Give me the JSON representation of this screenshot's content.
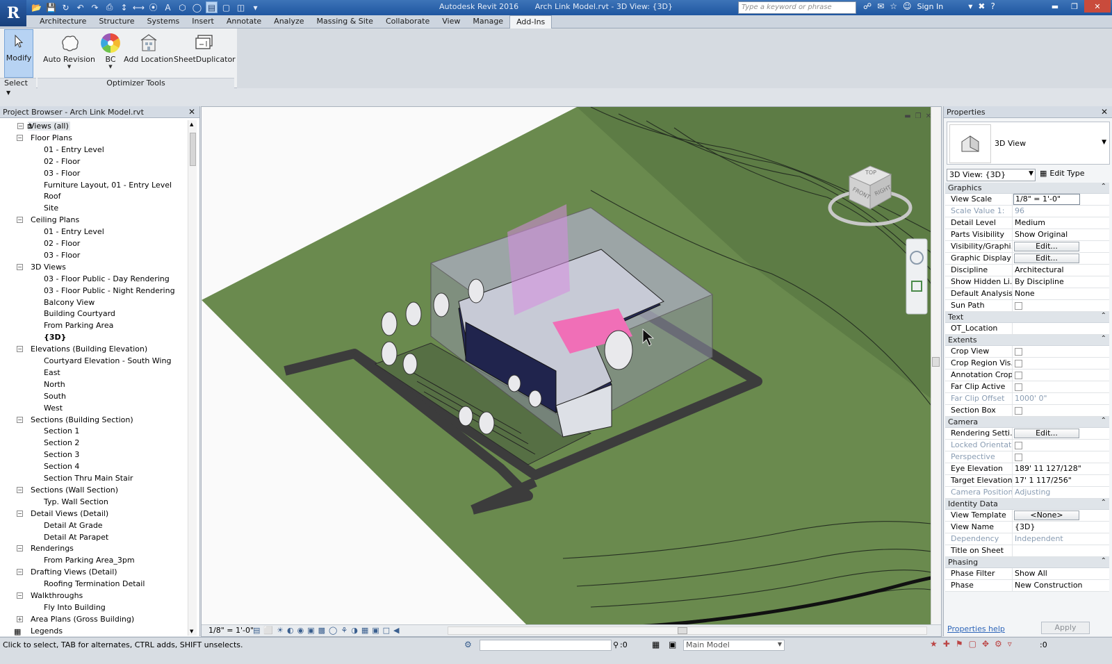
{
  "titlebar": {
    "app_letter": "R",
    "app_name": "Autodesk Revit 2016",
    "document": "Arch Link Model.rvt - 3D View: {3D}",
    "search_placeholder": "Type a keyword or phrase",
    "sign_in": "Sign In"
  },
  "tabs": [
    "Architecture",
    "Structure",
    "Systems",
    "Insert",
    "Annotate",
    "Analyze",
    "Massing & Site",
    "Collaborate",
    "View",
    "Manage",
    "Add-Ins"
  ],
  "active_tab": "Add-Ins",
  "ribbon": {
    "modify": "Modify",
    "auto_revision": "Auto Revision",
    "bc": "BC",
    "add_location": "Add Location",
    "sheet_duplicator": "SheetDuplicator",
    "select_label": "Select",
    "panel_label": "Optimizer Tools"
  },
  "project_browser": {
    "title": "Project Browser - Arch Link Model.rvt",
    "items": [
      {
        "label": "Views (all)",
        "level": 0,
        "expander": "-",
        "selected": true
      },
      {
        "label": "Floor Plans",
        "level": 1,
        "expander": "-"
      },
      {
        "label": "01 - Entry Level",
        "level": 2
      },
      {
        "label": "02 - Floor",
        "level": 2
      },
      {
        "label": "03 - Floor",
        "level": 2
      },
      {
        "label": "Furniture Layout,  01 - Entry Level",
        "level": 2
      },
      {
        "label": "Roof",
        "level": 2
      },
      {
        "label": "Site",
        "level": 2
      },
      {
        "label": "Ceiling Plans",
        "level": 1,
        "expander": "-"
      },
      {
        "label": "01 - Entry Level",
        "level": 2
      },
      {
        "label": "02 - Floor",
        "level": 2
      },
      {
        "label": "03 - Floor",
        "level": 2
      },
      {
        "label": "3D Views",
        "level": 1,
        "expander": "-"
      },
      {
        "label": "03 - Floor Public - Day Rendering",
        "level": 2
      },
      {
        "label": "03 - Floor Public - Night Rendering",
        "level": 2
      },
      {
        "label": "Balcony View",
        "level": 2
      },
      {
        "label": "Building Courtyard",
        "level": 2
      },
      {
        "label": "From Parking Area",
        "level": 2
      },
      {
        "label": "{3D}",
        "level": 2,
        "bold": true
      },
      {
        "label": "Elevations (Building Elevation)",
        "level": 1,
        "expander": "-"
      },
      {
        "label": "Courtyard Elevation - South Wing",
        "level": 2
      },
      {
        "label": "East",
        "level": 2
      },
      {
        "label": "North",
        "level": 2
      },
      {
        "label": "South",
        "level": 2
      },
      {
        "label": "West",
        "level": 2
      },
      {
        "label": "Sections (Building Section)",
        "level": 1,
        "expander": "-"
      },
      {
        "label": "Section 1",
        "level": 2
      },
      {
        "label": "Section 2",
        "level": 2
      },
      {
        "label": "Section 3",
        "level": 2
      },
      {
        "label": "Section 4",
        "level": 2
      },
      {
        "label": "Section Thru Main Stair",
        "level": 2
      },
      {
        "label": "Sections (Wall Section)",
        "level": 1,
        "expander": "-"
      },
      {
        "label": "Typ. Wall Section",
        "level": 2
      },
      {
        "label": "Detail Views (Detail)",
        "level": 1,
        "expander": "-"
      },
      {
        "label": "Detail At Grade",
        "level": 2
      },
      {
        "label": "Detail At Parapet",
        "level": 2
      },
      {
        "label": "Renderings",
        "level": 1,
        "expander": "-"
      },
      {
        "label": "From Parking Area_3pm",
        "level": 2
      },
      {
        "label": "Drafting Views (Detail)",
        "level": 1,
        "expander": "-"
      },
      {
        "label": "Roofing Termination Detail",
        "level": 2
      },
      {
        "label": "Walkthroughs",
        "level": 1,
        "expander": "-"
      },
      {
        "label": "Fly Into Building",
        "level": 2
      },
      {
        "label": "Area Plans (Gross Building)",
        "level": 1,
        "expander": "+"
      },
      {
        "label": "Legends",
        "level": 1,
        "icon": true
      }
    ]
  },
  "view": {
    "scale": "1/8\" = 1'-0\"",
    "cube_top": "TOP",
    "cube_front": "FRONT",
    "cube_right": "RIGHT"
  },
  "properties": {
    "title": "Properties",
    "type_name": "3D View",
    "view_selector": "3D View: {3D}",
    "edit_type": "Edit Type",
    "sections": [
      {
        "name": "Graphics",
        "rows": [
          {
            "k": "View Scale",
            "v": "1/8\" = 1'-0\"",
            "kind": "input"
          },
          {
            "k": "Scale Value    1:",
            "v": "96",
            "dis": true
          },
          {
            "k": "Detail Level",
            "v": "Medium"
          },
          {
            "k": "Parts Visibility",
            "v": "Show Original"
          },
          {
            "k": "Visibility/Graphi...",
            "v": "Edit...",
            "kind": "button"
          },
          {
            "k": "Graphic Display ...",
            "v": "Edit...",
            "kind": "button"
          },
          {
            "k": "Discipline",
            "v": "Architectural"
          },
          {
            "k": "Show Hidden Li...",
            "v": "By Discipline"
          },
          {
            "k": "Default Analysis...",
            "v": "None"
          },
          {
            "k": "Sun Path",
            "v": "",
            "kind": "check"
          }
        ]
      },
      {
        "name": "Text",
        "rows": [
          {
            "k": "OT_Location",
            "v": ""
          }
        ]
      },
      {
        "name": "Extents",
        "rows": [
          {
            "k": "Crop View",
            "v": "",
            "kind": "check"
          },
          {
            "k": "Crop Region Vis...",
            "v": "",
            "kind": "check"
          },
          {
            "k": "Annotation Crop",
            "v": "",
            "kind": "check"
          },
          {
            "k": "Far Clip Active",
            "v": "",
            "kind": "check"
          },
          {
            "k": "Far Clip Offset",
            "v": "1000'  0\"",
            "dis": true
          },
          {
            "k": "Section Box",
            "v": "",
            "kind": "check"
          }
        ]
      },
      {
        "name": "Camera",
        "rows": [
          {
            "k": "Rendering Setti...",
            "v": "Edit...",
            "kind": "button"
          },
          {
            "k": "Locked Orientat...",
            "v": "",
            "kind": "check",
            "dis": true
          },
          {
            "k": "Perspective",
            "v": "",
            "kind": "check",
            "dis": true
          },
          {
            "k": "Eye Elevation",
            "v": "189'  11 127/128\""
          },
          {
            "k": "Target Elevation",
            "v": "17'  1 117/256\""
          },
          {
            "k": "Camera Position",
            "v": "Adjusting",
            "dis": true
          }
        ]
      },
      {
        "name": "Identity Data",
        "rows": [
          {
            "k": "View Template",
            "v": "<None>",
            "kind": "button"
          },
          {
            "k": "View Name",
            "v": "{3D}"
          },
          {
            "k": "Dependency",
            "v": "Independent",
            "dis": true
          },
          {
            "k": "Title on Sheet",
            "v": ""
          }
        ]
      },
      {
        "name": "Phasing",
        "rows": [
          {
            "k": "Phase Filter",
            "v": "Show All"
          },
          {
            "k": "Phase",
            "v": "New Construction"
          }
        ]
      }
    ],
    "help": "Properties help",
    "apply": "Apply"
  },
  "status": {
    "text": "Click to select, TAB for alternates, CTRL adds, SHIFT unselects.",
    "zero": ":0",
    "model": "Main Model",
    "filter_zero": ":0"
  }
}
